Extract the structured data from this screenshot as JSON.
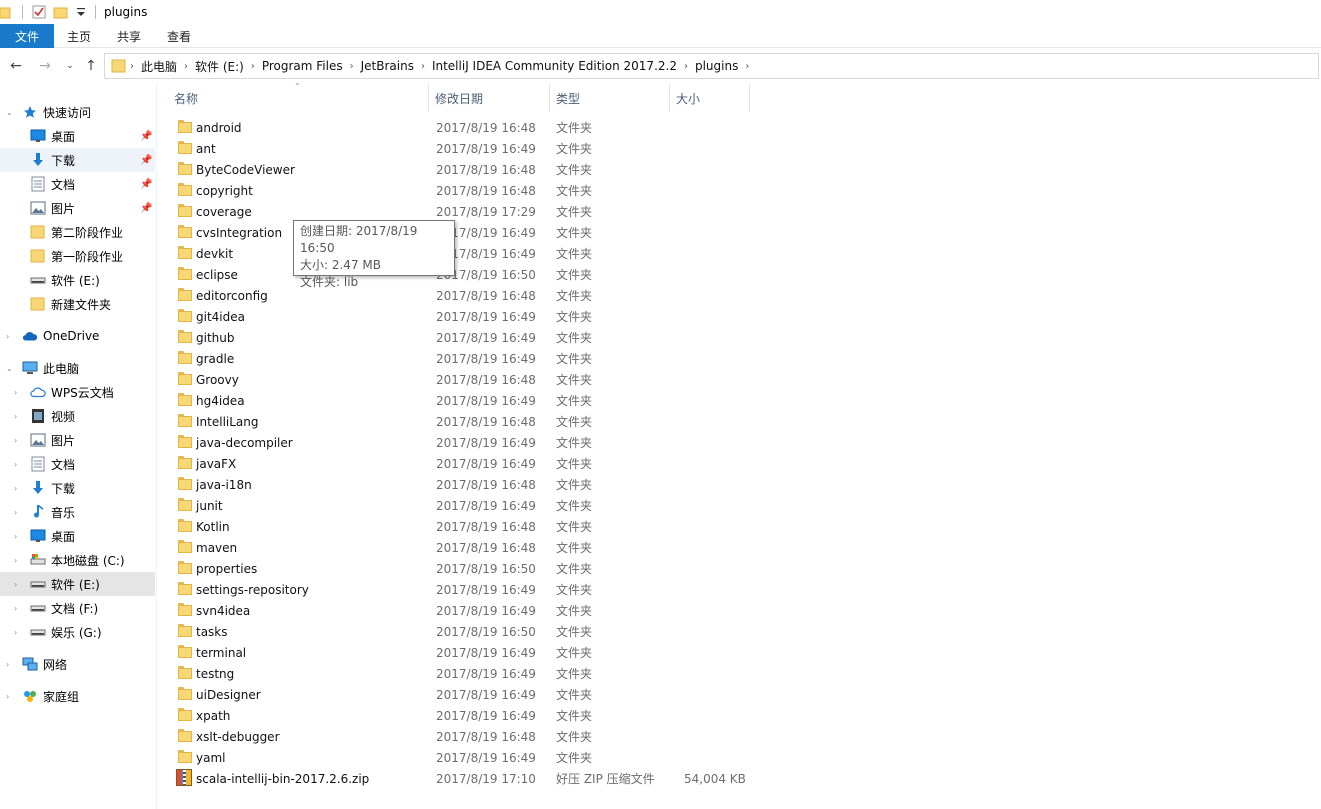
{
  "title": "plugins",
  "ribbon_tabs": [
    "文件",
    "主页",
    "共享",
    "查看"
  ],
  "breadcrumb": [
    "此电脑",
    "软件 (E:)",
    "Program Files",
    "JetBrains",
    "IntelliJ IDEA Community Edition 2017.2.2",
    "plugins"
  ],
  "nav": {
    "quick_access": "快速访问",
    "quick_items": [
      "桌面",
      "下载",
      "文档",
      "图片",
      "第二阶段作业",
      "第一阶段作业",
      "软件 (E:)",
      "新建文件夹"
    ],
    "onedrive": "OneDrive",
    "this_pc": "此电脑",
    "pc_items": [
      "WPS云文档",
      "视频",
      "图片",
      "文档",
      "下载",
      "音乐",
      "桌面",
      "本地磁盘 (C:)",
      "软件 (E:)",
      "文档 (F:)",
      "娱乐 (G:)"
    ],
    "network": "网络",
    "homegroup": "家庭组"
  },
  "columns": {
    "name": "名称",
    "date": "修改日期",
    "type": "类型",
    "size": "大小"
  },
  "files": [
    {
      "name": "android",
      "date": "2017/8/19 16:48",
      "type": "文件夹",
      "size": ""
    },
    {
      "name": "ant",
      "date": "2017/8/19 16:49",
      "type": "文件夹",
      "size": ""
    },
    {
      "name": "ByteCodeViewer",
      "date": "2017/8/19 16:48",
      "type": "文件夹",
      "size": ""
    },
    {
      "name": "copyright",
      "date": "2017/8/19 16:48",
      "type": "文件夹",
      "size": ""
    },
    {
      "name": "coverage",
      "date": "2017/8/19 17:29",
      "type": "文件夹",
      "size": ""
    },
    {
      "name": "cvsIntegration",
      "date": "2017/8/19 16:49",
      "type": "文件夹",
      "size": ""
    },
    {
      "name": "devkit",
      "date": "2017/8/19 16:49",
      "type": "文件夹",
      "size": ""
    },
    {
      "name": "eclipse",
      "date": "2017/8/19 16:50",
      "type": "文件夹",
      "size": ""
    },
    {
      "name": "editorconfig",
      "date": "2017/8/19 16:48",
      "type": "文件夹",
      "size": ""
    },
    {
      "name": "git4idea",
      "date": "2017/8/19 16:49",
      "type": "文件夹",
      "size": ""
    },
    {
      "name": "github",
      "date": "2017/8/19 16:49",
      "type": "文件夹",
      "size": ""
    },
    {
      "name": "gradle",
      "date": "2017/8/19 16:49",
      "type": "文件夹",
      "size": ""
    },
    {
      "name": "Groovy",
      "date": "2017/8/19 16:48",
      "type": "文件夹",
      "size": ""
    },
    {
      "name": "hg4idea",
      "date": "2017/8/19 16:49",
      "type": "文件夹",
      "size": ""
    },
    {
      "name": "IntelliLang",
      "date": "2017/8/19 16:48",
      "type": "文件夹",
      "size": ""
    },
    {
      "name": "java-decompiler",
      "date": "2017/8/19 16:49",
      "type": "文件夹",
      "size": ""
    },
    {
      "name": "javaFX",
      "date": "2017/8/19 16:49",
      "type": "文件夹",
      "size": ""
    },
    {
      "name": "java-i18n",
      "date": "2017/8/19 16:48",
      "type": "文件夹",
      "size": ""
    },
    {
      "name": "junit",
      "date": "2017/8/19 16:49",
      "type": "文件夹",
      "size": ""
    },
    {
      "name": "Kotlin",
      "date": "2017/8/19 16:48",
      "type": "文件夹",
      "size": ""
    },
    {
      "name": "maven",
      "date": "2017/8/19 16:48",
      "type": "文件夹",
      "size": ""
    },
    {
      "name": "properties",
      "date": "2017/8/19 16:50",
      "type": "文件夹",
      "size": ""
    },
    {
      "name": "settings-repository",
      "date": "2017/8/19 16:49",
      "type": "文件夹",
      "size": ""
    },
    {
      "name": "svn4idea",
      "date": "2017/8/19 16:49",
      "type": "文件夹",
      "size": ""
    },
    {
      "name": "tasks",
      "date": "2017/8/19 16:50",
      "type": "文件夹",
      "size": ""
    },
    {
      "name": "terminal",
      "date": "2017/8/19 16:49",
      "type": "文件夹",
      "size": ""
    },
    {
      "name": "testng",
      "date": "2017/8/19 16:49",
      "type": "文件夹",
      "size": ""
    },
    {
      "name": "uiDesigner",
      "date": "2017/8/19 16:49",
      "type": "文件夹",
      "size": ""
    },
    {
      "name": "xpath",
      "date": "2017/8/19 16:49",
      "type": "文件夹",
      "size": ""
    },
    {
      "name": "xslt-debugger",
      "date": "2017/8/19 16:48",
      "type": "文件夹",
      "size": ""
    },
    {
      "name": "yaml",
      "date": "2017/8/19 16:49",
      "type": "文件夹",
      "size": ""
    },
    {
      "name": "scala-intellij-bin-2017.2.6.zip",
      "date": "2017/8/19 17:10",
      "type": "好压 ZIP 压缩文件",
      "size": "54,004 KB",
      "icon": "zip-archive-icon"
    }
  ],
  "tooltip": {
    "created": "创建日期: 2017/8/19 16:50",
    "size": "大小: 2.47 MB",
    "folders": "文件夹: lib"
  },
  "colors": {
    "accent": "#1979ca",
    "folder": "#f8d775",
    "selected_nav": "#e5e5e5"
  }
}
